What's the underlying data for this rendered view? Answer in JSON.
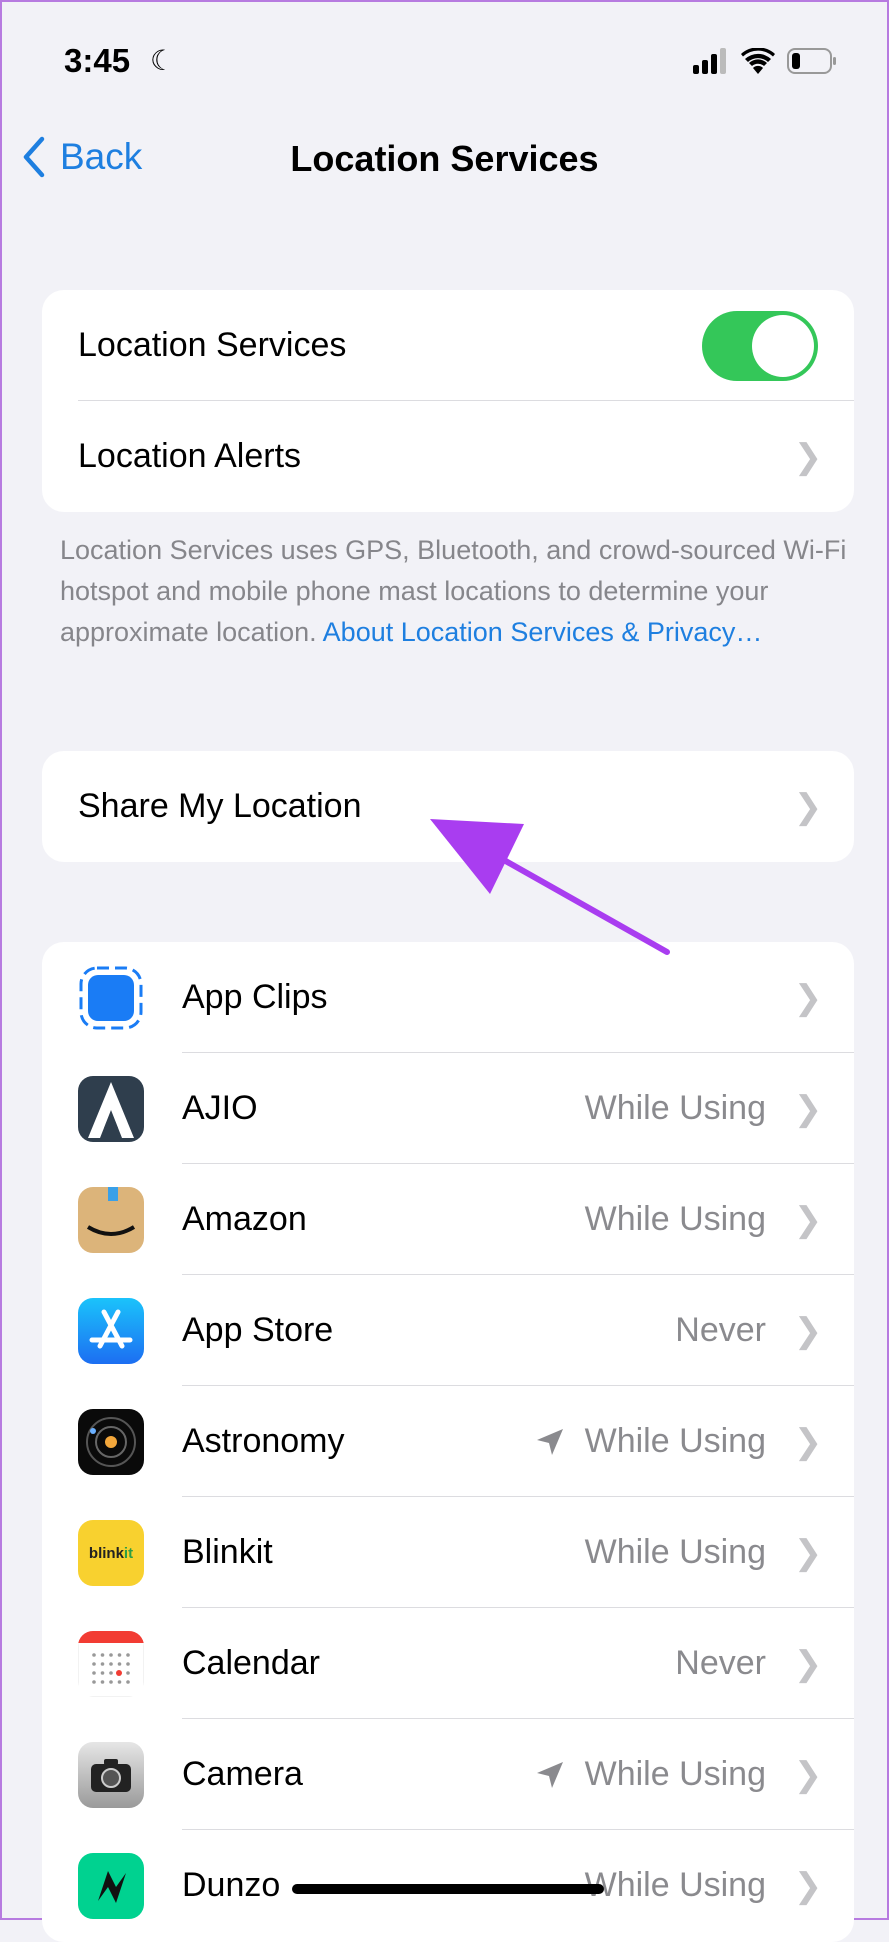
{
  "status": {
    "time": "3:45"
  },
  "nav": {
    "back_label": "Back",
    "title": "Location Services"
  },
  "main_section": {
    "location_services_label": "Location Services",
    "location_services_on": true,
    "location_alerts_label": "Location Alerts"
  },
  "footer": {
    "text": "Location Services uses GPS, Bluetooth, and crowd-sourced Wi-Fi hotspot and mobile phone mast locations to determine your approximate location. ",
    "link": "About Location Services & Privacy…"
  },
  "share": {
    "label": "Share My Location"
  },
  "apps": [
    {
      "name": "App Clips",
      "value": "",
      "arrow": false,
      "icon": "app-clips-icon"
    },
    {
      "name": "AJIO",
      "value": "While Using",
      "arrow": false,
      "icon": "ajio-icon"
    },
    {
      "name": "Amazon",
      "value": "While Using",
      "arrow": false,
      "icon": "amazon-icon"
    },
    {
      "name": "App Store",
      "value": "Never",
      "arrow": false,
      "icon": "app-store-icon"
    },
    {
      "name": "Astronomy",
      "value": "While Using",
      "arrow": true,
      "icon": "astronomy-icon"
    },
    {
      "name": "Blinkit",
      "value": "While Using",
      "arrow": false,
      "icon": "blinkit-icon",
      "icon_text": "blinkit"
    },
    {
      "name": "Calendar",
      "value": "Never",
      "arrow": false,
      "icon": "calendar-icon"
    },
    {
      "name": "Camera",
      "value": "While Using",
      "arrow": true,
      "icon": "camera-icon"
    },
    {
      "name": "Dunzo",
      "value": "While Using",
      "arrow": false,
      "icon": "dunzo-icon"
    }
  ],
  "colors": {
    "accent": "#1e7fe0",
    "toggle_on": "#34c759",
    "annotation_arrow": "#a93df0"
  }
}
